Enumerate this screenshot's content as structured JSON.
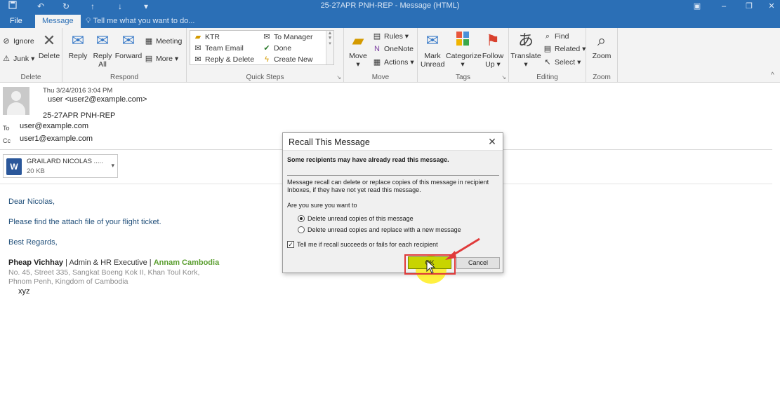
{
  "window": {
    "title": "25-27APR PNH-REP - Message (HTML)",
    "qat_icons": [
      "save-icon",
      "undo-icon",
      "redo-icon",
      "up-arrow-icon",
      "down-arrow-icon",
      "customize-icon"
    ]
  },
  "tabs": [
    {
      "label": "File",
      "active": false
    },
    {
      "label": "Message",
      "active": true
    }
  ],
  "tell_me": "Tell me what you want to do...",
  "ribbon": {
    "delete_group": {
      "label": "Delete",
      "ignore": "Ignore",
      "junk": "Junk",
      "delete": "Delete"
    },
    "respond_group": {
      "label": "Respond",
      "reply": "Reply",
      "reply_all_1": "Reply",
      "reply_all_2": "All",
      "forward": "Forward",
      "meeting": "Meeting",
      "more": "More"
    },
    "quick_steps_group": {
      "label": "Quick Steps",
      "items": [
        "KTR",
        "Team Email",
        "Reply & Delete",
        "To Manager",
        "Done",
        "Create New"
      ]
    },
    "move_group": {
      "label": "Move",
      "move": "Move",
      "rules": "Rules",
      "onenote": "OneNote",
      "actions": "Actions"
    },
    "tags_group": {
      "label": "Tags",
      "mark_unread_1": "Mark",
      "mark_unread_2": "Unread",
      "categorize": "Categorize",
      "follow_up_1": "Follow",
      "follow_up_2": "Up"
    },
    "editing_group": {
      "label": "Editing",
      "translate": "Translate",
      "find": "Find",
      "related": "Related",
      "select": "Select"
    },
    "zoom_group": {
      "label": "Zoom",
      "zoom": "Zoom"
    }
  },
  "message": {
    "date": "Thu 3/24/2016 3:04 PM",
    "from": "user <user2@example.com>",
    "subject": "25-27APR PNH-REP",
    "to_label": "To",
    "to": "user@example.com",
    "cc_label": "Cc",
    "cc": "user1@example.com",
    "attachment_name": "GRAILARD NICOLAS .....",
    "attachment_size": "20 KB"
  },
  "body": {
    "greeting": "Dear Nicolas,",
    "line1": "Please find the attach file of your flight ticket.",
    "closing": "Best Regards,",
    "sig_name": "Pheap Vichhay",
    "sig_sep1": " | ",
    "sig_title": "Admin & HR Executive",
    "sig_sep2": " | ",
    "sig_company": "Annam Cambodia",
    "address1": "No. 45, Street 335, Sangkat Boeng Kok II, Khan Toul Kork,",
    "address2": "Phnom Penh, Kingdom of Cambodia",
    "extra": "xyz"
  },
  "dialog": {
    "title": "Recall This Message",
    "warning": "Some recipients may have already read this message.",
    "description_1": "Message recall can delete or replace copies of this message in recipient",
    "description_2": "Inboxes, if they have not yet read this message.",
    "question": "Are you sure you want to",
    "option_delete": "Delete unread copies of this message",
    "option_replace": "Delete unread copies and replace with a new message",
    "selected_option": "delete",
    "tell_me_label": "Tell me if recall succeeds or fails for each recipient",
    "tell_me_checked": true,
    "ok": "OK",
    "cancel": "Cancel"
  },
  "colors": {
    "titlebar": "#2b6fb6",
    "ok_button": "#c8d400",
    "highlight_box": "#e03a3a",
    "signature_company": "#5a9e2f",
    "body_text": "#1f4e79"
  }
}
